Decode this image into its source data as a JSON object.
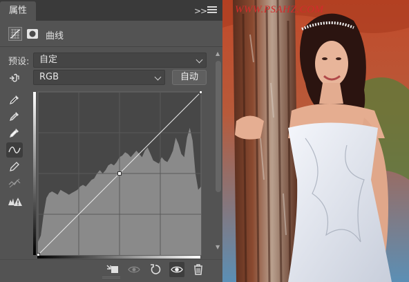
{
  "panel": {
    "tab_label": "属性",
    "tab_close": "×",
    "collapse_label": "»",
    "header_title": "曲线"
  },
  "preset": {
    "label": "预设:",
    "value": "自定"
  },
  "channel": {
    "value": "RGB"
  },
  "auto_button": "自动",
  "tools": [
    "hand-target-icon",
    "black-eyedropper-icon",
    "gray-eyedropper-icon",
    "white-eyedropper-icon",
    "curve-edit-icon",
    "pencil-icon",
    "smooth-icon",
    "clipping-warning-icon"
  ],
  "curve": {
    "points_normalized": [
      [
        0,
        0
      ],
      [
        0.5,
        0.5
      ],
      [
        1,
        1
      ]
    ],
    "histogram_profile": [
      0.08,
      0.12,
      0.25,
      0.35,
      0.38,
      0.39,
      0.38,
      0.37,
      0.4,
      0.39,
      0.38,
      0.37,
      0.38,
      0.39,
      0.4,
      0.42,
      0.43,
      0.42,
      0.44,
      0.46,
      0.47,
      0.5,
      0.52,
      0.5,
      0.52,
      0.55,
      0.56,
      0.55,
      0.57,
      0.6,
      0.61,
      0.63,
      0.62,
      0.6,
      0.62,
      0.64,
      0.62,
      0.6,
      0.64,
      0.66,
      0.62,
      0.58,
      0.57,
      0.56,
      0.6,
      0.58,
      0.57,
      0.6,
      0.64,
      0.72,
      0.68,
      0.62,
      0.6,
      0.72,
      0.78,
      0.7,
      0.5,
      0.4,
      0.42
    ],
    "histogram_color": "#8a8a8a",
    "graph_bg": "#474747",
    "curve_color": "#e8e8e8"
  },
  "bottom_bar": [
    "clip-to-layer-icon",
    "view-previous-state-icon",
    "reset-icon",
    "visibility-eye-icon",
    "trash-icon"
  ],
  "watermark": "WWW.PSAHZ.COM"
}
